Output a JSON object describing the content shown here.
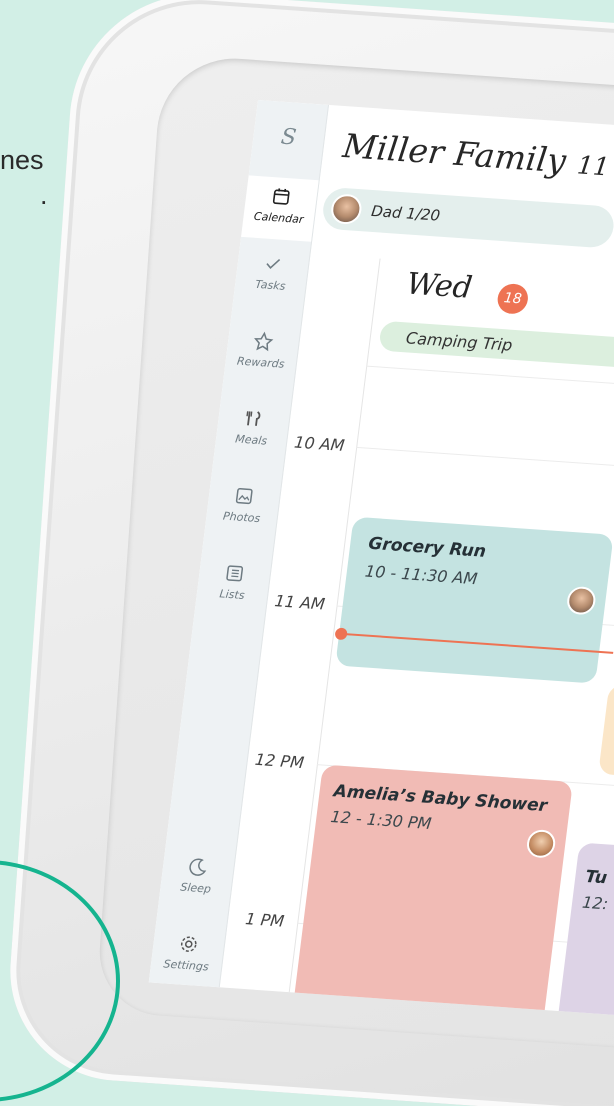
{
  "background_text": {
    "line1": "nes",
    "line2": "."
  },
  "app": {
    "logo": "S",
    "title": "Miller Family",
    "date_fragment": "11",
    "profile_pill": "Dad 1/20"
  },
  "sidebar": {
    "items": [
      {
        "label": "Calendar",
        "icon": "calendar-icon"
      },
      {
        "label": "Tasks",
        "icon": "check-icon"
      },
      {
        "label": "Rewards",
        "icon": "star-icon"
      },
      {
        "label": "Meals",
        "icon": "utensils-icon"
      },
      {
        "label": "Photos",
        "icon": "photo-icon"
      },
      {
        "label": "Lists",
        "icon": "list-icon"
      },
      {
        "label": "Sleep",
        "icon": "moon-icon"
      },
      {
        "label": "Settings",
        "icon": "gear-icon"
      }
    ]
  },
  "day": {
    "name": "Wed",
    "number": "18",
    "all_day_event": "Camping Trip"
  },
  "hours": [
    "10 AM",
    "11 AM",
    "12 PM",
    "1 PM"
  ],
  "events": [
    {
      "title": "Grocery Run",
      "time": "10 - 11:30 AM",
      "color": "#c4e3e1"
    },
    {
      "title": "Amelia’s Baby Shower",
      "time": "12 - 1:30 PM",
      "color": "#f1bbb5"
    },
    {
      "title": "Tu",
      "time": "12:",
      "color": "#ddd3e6"
    }
  ],
  "colors": {
    "accent": "#ee7353",
    "ring": "#15b48f",
    "background": "#d2efe6"
  }
}
